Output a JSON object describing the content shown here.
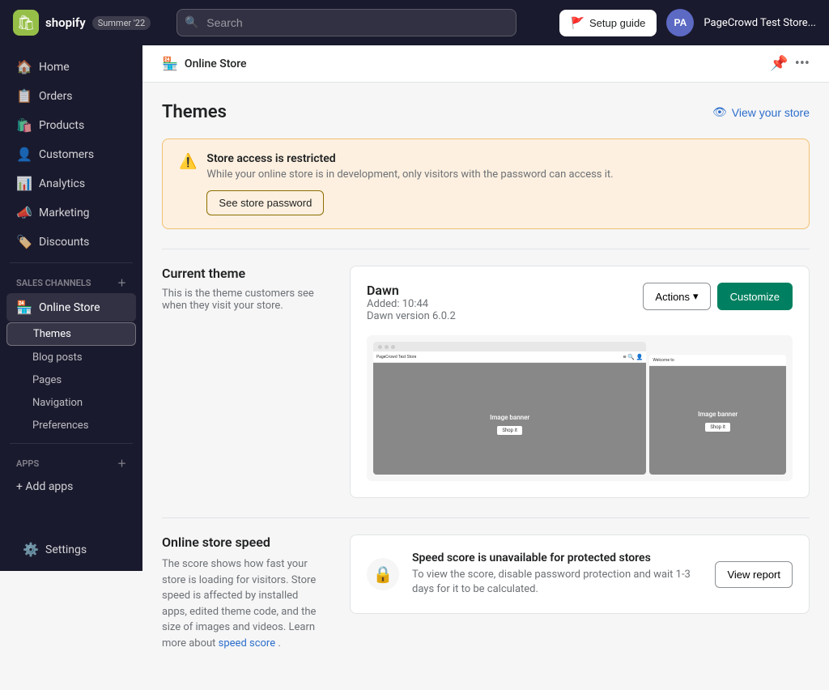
{
  "topNav": {
    "logoText": "shopify",
    "versionBadge": "Summer '22",
    "searchPlaceholder": "Search",
    "setupGuideLabel": "Setup guide",
    "avatarInitials": "PA",
    "storeName": "PageCrowd Test Store..."
  },
  "sidebar": {
    "mainItems": [
      {
        "id": "home",
        "label": "Home",
        "icon": "🏠"
      },
      {
        "id": "orders",
        "label": "Orders",
        "icon": "📋"
      },
      {
        "id": "products",
        "label": "Products",
        "icon": "🛍️"
      },
      {
        "id": "customers",
        "label": "Customers",
        "icon": "👤"
      },
      {
        "id": "analytics",
        "label": "Analytics",
        "icon": "📊"
      },
      {
        "id": "marketing",
        "label": "Marketing",
        "icon": "📣"
      },
      {
        "id": "discounts",
        "label": "Discounts",
        "icon": "🏷️"
      }
    ],
    "salesChannelsLabel": "Sales channels",
    "salesChannels": [
      {
        "id": "online-store",
        "label": "Online Store",
        "icon": "🏪"
      }
    ],
    "onlineStoreSubItems": [
      {
        "id": "themes",
        "label": "Themes",
        "active": true
      },
      {
        "id": "blog-posts",
        "label": "Blog posts"
      },
      {
        "id": "pages",
        "label": "Pages"
      },
      {
        "id": "navigation",
        "label": "Navigation"
      },
      {
        "id": "preferences",
        "label": "Preferences"
      }
    ],
    "appsLabel": "Apps",
    "addAppsLabel": "+ Add apps",
    "settingsLabel": "Settings",
    "settingsIcon": "⚙️"
  },
  "pageHeader": {
    "breadcrumbIcon": "🏪",
    "breadcrumbText": "Online Store"
  },
  "themes": {
    "title": "Themes",
    "viewStoreLabel": "View your store",
    "alert": {
      "title": "Store access is restricted",
      "description": "While your online store is in development, only visitors with the password can access it.",
      "buttonLabel": "See store password"
    },
    "currentThemeSection": {
      "title": "Current theme",
      "description": "This is the theme customers see when they visit your store.",
      "card": {
        "themeName": "Dawn",
        "addedLabel": "Added: 10:44",
        "versionLabel": "Dawn version 6.0.2",
        "actionsLabel": "Actions",
        "customizeLabel": "Customize"
      }
    },
    "speedSection": {
      "title": "Online store speed",
      "description": "The score shows how fast your store is loading for visitors. Store speed is affected by installed apps, edited theme code, and the size of images and videos. Learn more about",
      "linkLabel": "speed score",
      "descEnd": ".",
      "card": {
        "title": "Speed score is unavailable for protected stores",
        "description": "To view the score, disable password protection and wait 1-3 days for it to be calculated.",
        "buttonLabel": "View report"
      }
    }
  }
}
